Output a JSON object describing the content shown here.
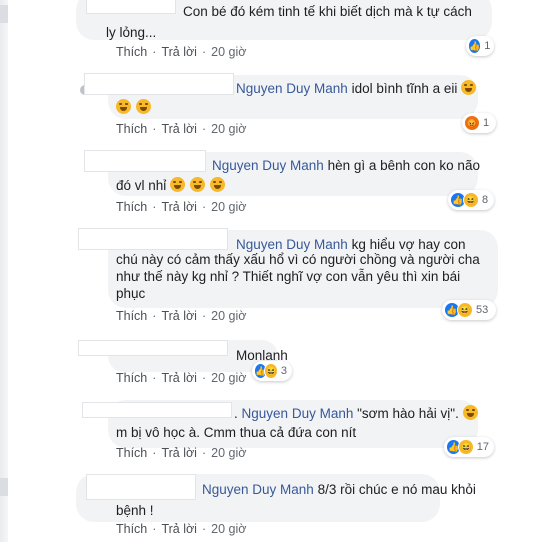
{
  "comments": [
    {
      "name": "",
      "text_line1": "Con bé đó kém tinh tế khi biết dịch mà k tự cách",
      "text_line2": "ly lỏng...",
      "actions": {
        "like": "Thích",
        "reply": "Trả lời",
        "time": "20 giờ"
      },
      "reactions": {
        "icons": [
          "like-icon"
        ],
        "count": "1"
      }
    },
    {
      "name": "Nguyen Duy Manh",
      "text_line1": "idol bình tĩnh a eii",
      "text_line2": "",
      "emojis_after_line1": [
        "laughing-emoji"
      ],
      "emojis_line2": [
        "laughing-emoji",
        "laughing-emoji"
      ],
      "actions": {
        "like": "Thích",
        "reply": "Trả lời",
        "time": "20 giờ"
      },
      "reactions": {
        "icons": [
          "angry-icon"
        ],
        "count": "1"
      }
    },
    {
      "name": "Nguyen Duy Manh",
      "text_line1": "hèn gì a bênh con ko não",
      "text_line2": "đó vl nhỉ",
      "emojis_line2": [
        "grin-emoji",
        "grin-emoji",
        "grin-emoji"
      ],
      "actions": {
        "like": "Thích",
        "reply": "Trả lời",
        "time": "20 giờ"
      },
      "reactions": {
        "icons": [
          "like-icon",
          "haha-icon"
        ],
        "count": "8"
      }
    },
    {
      "name": "Nguyen Duy Manh",
      "text_line1": "kg hiểu vợ hay con",
      "text_line2": "chú này có cảm thấy xấu hổ vì có người chồng và người cha",
      "text_line3": "như thế này kg nhỉ ? Thiết nghĩ vợ con vẫn yêu thì xin bái",
      "text_line4": "phục",
      "actions": {
        "like": "Thích",
        "reply": "Trả lời",
        "time": "20 giờ"
      },
      "reactions": {
        "icons": [
          "like-icon",
          "haha-icon"
        ],
        "count": "53"
      }
    },
    {
      "name": "",
      "text_line1": "Monlanh",
      "actions": {
        "like": "Thích",
        "reply": "Trả lời",
        "time": "20 giờ"
      },
      "reactions": {
        "icons": [
          "like-icon",
          "haha-icon"
        ],
        "count": "3"
      }
    },
    {
      "name": "Nguyen Duy Manh",
      "prefix": ".",
      "text_line1": "\"sơm hào hải vị\".",
      "text_line2": "m bị vô học à. Cmm thua cả đứa con nít",
      "emojis_after_line1": [
        "laughing-emoji"
      ],
      "actions": {
        "like": "Thích",
        "reply": "Trả lời",
        "time": "20 giờ"
      },
      "reactions": {
        "icons": [
          "like-icon",
          "haha-icon"
        ],
        "count": "17"
      }
    },
    {
      "name": "Nguyen Duy Manh",
      "text_line1": "8/3 rồi chúc e nó mau khỏi",
      "text_line2": "bệnh !",
      "actions": {
        "like": "Thích",
        "reply": "Trả lời",
        "time": "20 giờ"
      }
    }
  ],
  "colors": {
    "name": "#385898",
    "bubble": "#f2f3f5",
    "like": "#1877f2",
    "haha": "#f7b928",
    "angry": "#e9710f"
  }
}
